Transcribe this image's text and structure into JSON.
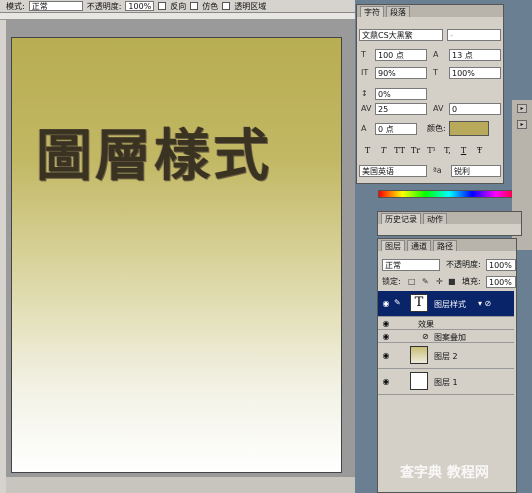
{
  "toolbar": {
    "mode_label": "模式:",
    "mode_value": "正常",
    "opacity_label": "不透明度:",
    "opacity_value": "100%",
    "reverse_label": "反向",
    "dither_label": "仿色",
    "transparency_label": "透明区域"
  },
  "canvas": {
    "text": "圖層樣式"
  },
  "char_panel": {
    "tabs": [
      "字符",
      "段落"
    ],
    "font_family": "文鼎CS大黑繁",
    "font_style": "-",
    "font_size": "100 点",
    "leading": "13 点",
    "vscale": "90%",
    "hscale": "100%",
    "baseline_pct": "0%",
    "tracking": "25",
    "kerning": "0",
    "baseline_shift": "0 点",
    "color_label": "颜色:",
    "color": "#b9a95a",
    "style_buttons": [
      "T",
      "T",
      "TT",
      "Tr",
      "T¹",
      "T,",
      "T",
      "Ŧ"
    ],
    "language": "美国英语",
    "aa_label": "ªa",
    "aa_value": "锐利"
  },
  "history_panel": {
    "tabs": [
      "历史记录",
      "动作"
    ]
  },
  "layers_panel": {
    "tabs": [
      "图层",
      "通道",
      "路径"
    ],
    "blend_mode": "正常",
    "opacity_label": "不透明度:",
    "opacity_value": "100%",
    "lock_label": "锁定:",
    "fill_label": "填充:",
    "fill_value": "100%",
    "text_layer_name": "图层样式",
    "effects_label": "效果",
    "pattern_overlay_label": "图案叠加",
    "layer2_name": "图层 2",
    "layer1_name": "图层 1"
  },
  "watermark": {
    "text": "查字典 教程网"
  }
}
